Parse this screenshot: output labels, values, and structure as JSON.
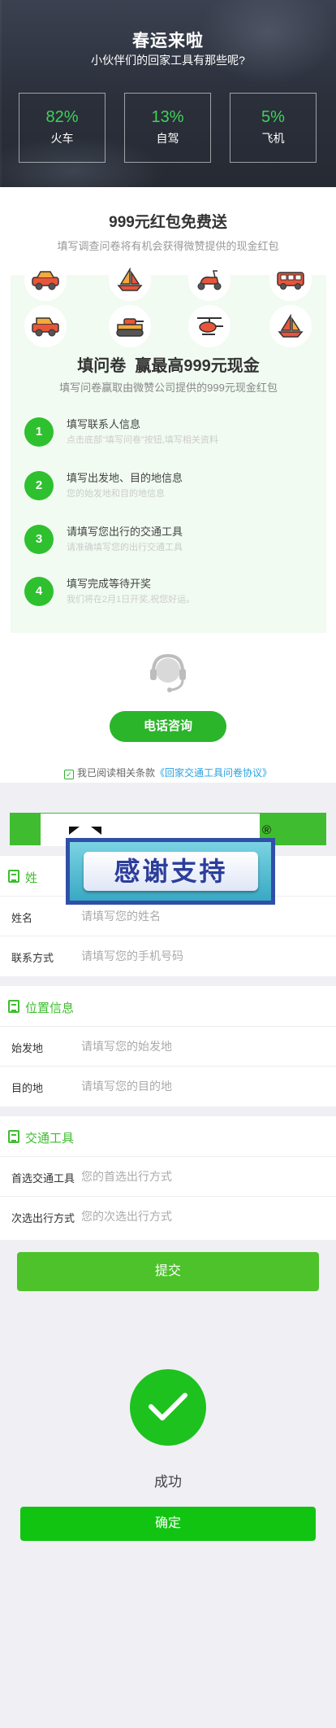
{
  "hero": {
    "title": "春运来啦",
    "subtitle": "小伙伴们的回家工具有那些呢?",
    "stats": [
      {
        "percent": "82%",
        "label": "火车"
      },
      {
        "percent": "13%",
        "label": "自驾"
      },
      {
        "percent": "5%",
        "label": "飞机"
      }
    ]
  },
  "promo": {
    "title": "999元红包免费送",
    "subtitle": "填写调查问卷将有机会获得微赞提供的现金红包",
    "icons": [
      "car-icon",
      "sailboat-icon",
      "scooter-icon",
      "bus-icon",
      "jeep-icon",
      "tank-icon",
      "helicopter-icon",
      "sailboat-icon"
    ],
    "panel_title": "填问卷  赢最高999元现金",
    "panel_subtitle": "填写问卷赢取由微赞公司提供的999元现金红包",
    "steps": [
      {
        "num": "1",
        "title": "填写联系人信息",
        "desc": "点击底部\"填写问卷\"按钮,填写相关资料"
      },
      {
        "num": "2",
        "title": "填写出发地、目的地信息",
        "desc": "您的始发地和目的地信息"
      },
      {
        "num": "3",
        "title": "请填写您出行的交通工具",
        "desc": "请准确填写您的出行交通工具"
      },
      {
        "num": "4",
        "title": "填写完成等待开奖",
        "desc": "我们将在2月1日开奖,祝您好运。"
      }
    ]
  },
  "consult": {
    "button": "电话咨询",
    "agree_prefix": "我已阅读相关条款",
    "agree_link": "《回家交通工具问卷协议》"
  },
  "overlay": {
    "thanks": "感谢支持",
    "registered": "®"
  },
  "form": {
    "contact": {
      "heading": "姓名",
      "heading_partial": "姓",
      "fields": [
        {
          "label": "姓名",
          "placeholder": "请填写您的姓名"
        },
        {
          "label": "联系方式",
          "placeholder": "请填写您的手机号码"
        }
      ]
    },
    "location": {
      "heading": "位置信息",
      "fields": [
        {
          "label": "始发地",
          "placeholder": "请填写您的始发地"
        },
        {
          "label": "目的地",
          "placeholder": "请填写您的目的地"
        }
      ]
    },
    "transport": {
      "heading": "交通工具",
      "fields": [
        {
          "label": "首选交通工具",
          "placeholder": "您的首选出行方式"
        },
        {
          "label": "次选出行方式",
          "placeholder": "您的次选出行方式"
        }
      ]
    },
    "submit": "提交"
  },
  "success": {
    "text": "成功",
    "button": "确定"
  },
  "colors": {
    "accent_green": "#3fbc2f",
    "stat_green": "#3fd25a",
    "link_blue": "#2aa0e0"
  }
}
